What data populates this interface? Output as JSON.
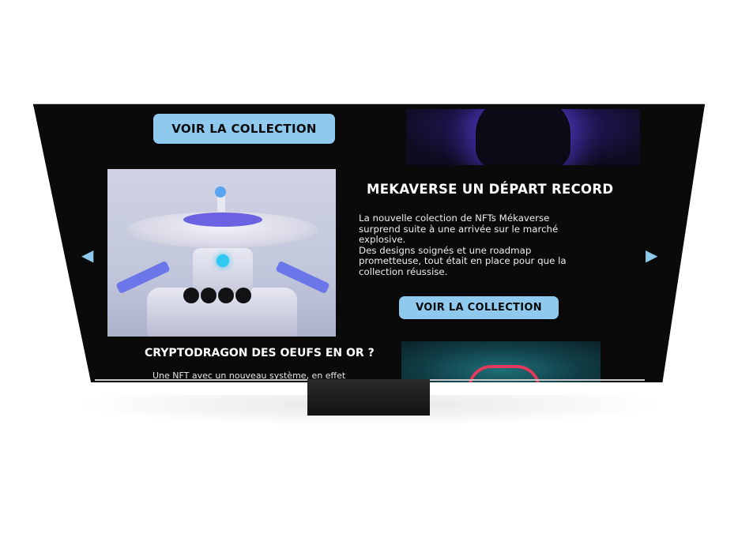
{
  "tv_screen": {
    "top_button_label": "VOIR LA COLLECTION",
    "featured": {
      "title": "MEKAVERSE UN DÉPART RECORD",
      "description_lines": [
        "La nouvelle colection de NFTs Mékaverse",
        "surprend suite à une arrivée sur le marché",
        "explosive.",
        "Des designs soignés et une roadmap",
        "prometteuse, tout était en place pour que la",
        "collection réussise."
      ],
      "button_label": "VOIR LA COLLECTION"
    },
    "next_item": {
      "title": "CRYPTODRAGON DES OEUFS EN OR ?",
      "description": "Une NFT avec un nouveau système, en effet"
    },
    "nav": {
      "left_arrow": "◀",
      "right_arrow": "▶"
    },
    "colors": {
      "accent": "#8fc9ee",
      "screen_bg": "#0a0a0a"
    },
    "icons": [
      "left-arrow-icon",
      "right-arrow-icon"
    ]
  }
}
